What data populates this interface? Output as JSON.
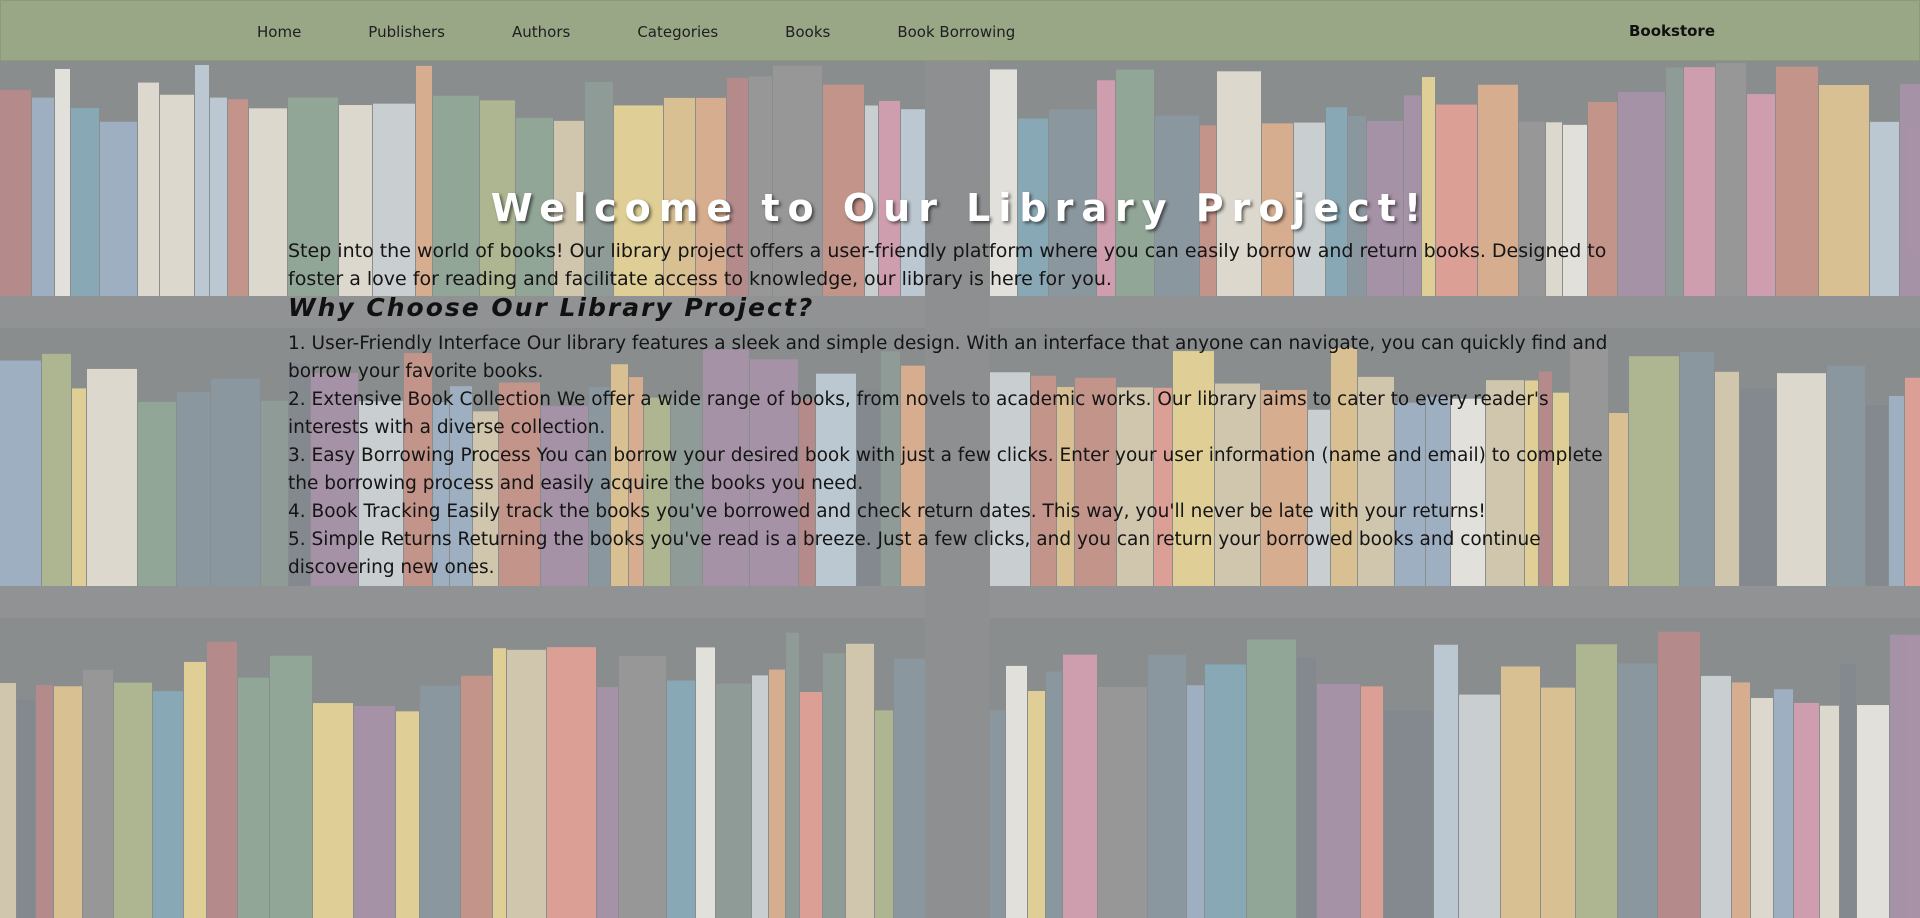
{
  "nav": {
    "links": [
      "Home",
      "Publishers",
      "Authors",
      "Categories",
      "Books",
      "Book Borrowing"
    ],
    "brand": "Bookstore"
  },
  "hero": {
    "title": "Welcome to Our Library Project!",
    "intro": "Step into the world of books! Our library project offers a user-friendly platform where you can easily borrow and return books. Designed to foster a love for reading and facilitate access to knowledge, our library is here for you.",
    "why_heading": "Why Choose Our Library Project?",
    "reasons": [
      "1. User-Friendly Interface Our library features a sleek and simple design. With an interface that anyone can navigate, you can quickly find and borrow your favorite books.",
      "2. Extensive Book Collection We offer a wide range of books, from novels to academic works. Our library aims to cater to every reader's interests with a diverse collection.",
      "3. Easy Borrowing Process You can borrow your desired book with just a few clicks. Enter your user information (name and email) to complete the borrowing process and easily acquire the books you need.",
      "4. Book Tracking Easily track the books you've borrowed and check return dates. This way, you'll never be late with your returns!",
      "5. Simple Returns Returning the books you've read is a breeze. Just a few clicks, and you can return your borrowed books and continue discovering new ones."
    ]
  },
  "colors": {
    "navbar": "#9aa786",
    "title_text": "#ffffff",
    "body_text": "#151515"
  }
}
